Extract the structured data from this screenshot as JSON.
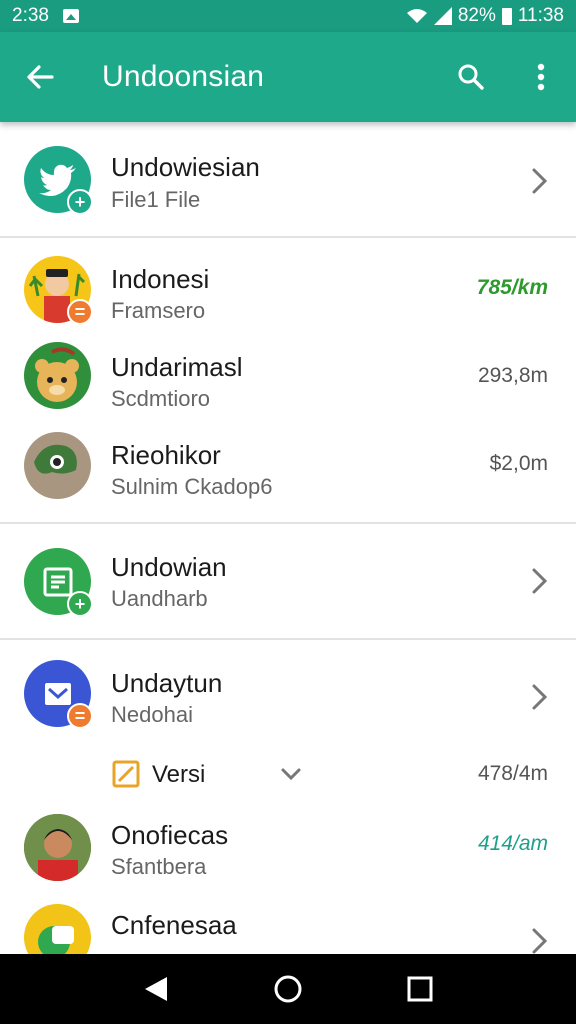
{
  "status_bar": {
    "time_left": "2:38",
    "battery_percent": "82%",
    "clock": "11:38"
  },
  "app_bar": {
    "title": "Undoonsian"
  },
  "rows": [
    {
      "title": "Undowiesian",
      "subtitle": "File1 File",
      "meta": ""
    },
    {
      "title": "Indonesi",
      "subtitle": "Framsero",
      "meta": "785/km"
    },
    {
      "title": "Undarimasl",
      "subtitle": "Scdmtioro",
      "meta": "293,8m"
    },
    {
      "title": "Rieohikor",
      "subtitle": "Sulnim Ckadop6",
      "meta": "$2,0m"
    },
    {
      "title": "Undowian",
      "subtitle": "Uandharb",
      "meta": ""
    },
    {
      "title": "Undaytun",
      "subtitle": "Nedohai",
      "meta": ""
    },
    {
      "title": "Versi",
      "subtitle": "",
      "meta": "478/4m"
    },
    {
      "title": "Onofiecas",
      "subtitle": "Sfantbera",
      "meta": "414/am"
    },
    {
      "title": "Cnfenesaa",
      "subtitle": "",
      "meta": ""
    }
  ],
  "colors": {
    "app_bar": "#1fa98b",
    "status_bar": "#1a9c80",
    "meta_green": "#2e9a2e",
    "meta_teal": "#1fa08a"
  },
  "icons": [
    "back-arrow-icon",
    "search-icon",
    "more-vert-icon",
    "twitter-bird-icon",
    "document-icon",
    "mail-icon",
    "edit-icon",
    "chevron-right-icon",
    "chevron-down-icon",
    "nav-back-icon",
    "nav-home-icon",
    "nav-recents-icon"
  ]
}
